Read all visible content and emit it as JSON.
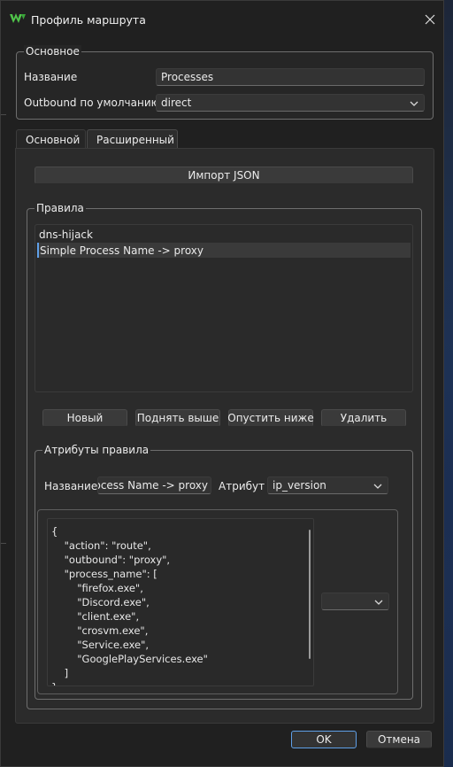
{
  "window": {
    "title": "Профиль маршрута",
    "accent": "#5fa0e8",
    "app_icon": "app-logo-icon",
    "close_icon": "close-icon"
  },
  "basic_group": {
    "title": "Основное",
    "name_label": "Название",
    "name_value": "Processes",
    "outbound_label": "Outbound по умолчанию",
    "outbound_value": "direct"
  },
  "tabs": [
    {
      "label": "Основной",
      "active": false
    },
    {
      "label": "Расширенный",
      "active": true
    }
  ],
  "advanced": {
    "import_button": "Импорт JSON",
    "rules_group_title": "Правила",
    "rules": [
      {
        "label": "dns-hijack",
        "selected": false
      },
      {
        "label": "Simple Process Name -> proxy",
        "selected": true
      }
    ],
    "buttons": {
      "new": "Новый",
      "move_up": "Поднять выше",
      "move_down": "Опустить ниже",
      "delete": "Удалить"
    },
    "attributes_group": {
      "title": "Атрибуты правила",
      "name_label": "Название",
      "name_value": "Process Name -> proxy",
      "attribute_label": "Атрибут",
      "attribute_value": "ip_version",
      "json_text": "{\n    \"action\": \"route\",\n    \"outbound\": \"proxy\",\n    \"process_name\": [\n        \"firefox.exe\",\n        \"Discord.exe\",\n        \"client.exe\",\n        \"crosvm.exe\",\n        \"Service.exe\",\n        \"GooglePlayServices.exe\"\n    ]\n}",
      "value_combo": ""
    }
  },
  "footer": {
    "ok": "OK",
    "cancel": "Отмена"
  }
}
